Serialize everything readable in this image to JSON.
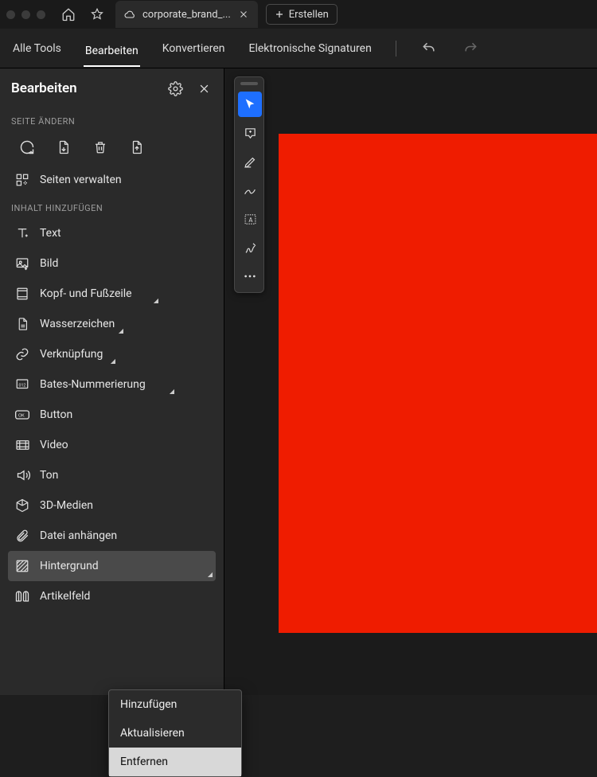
{
  "winbar": {
    "tab_name": "corporate_brand_...",
    "create_label": "Erstellen"
  },
  "menubar": {
    "items": [
      "Alle Tools",
      "Bearbeiten",
      "Konvertieren",
      "Elektronische Signaturen"
    ],
    "active_index": 1
  },
  "panel": {
    "title": "Bearbeiten",
    "section_page": "SEITE ÄNDERN",
    "manage_pages": "Seiten verwalten",
    "section_content": "INHALT HINZUFÜGEN",
    "items": [
      {
        "label": "Text",
        "icon": "text-icon",
        "dropdown": false
      },
      {
        "label": "Bild",
        "icon": "image-icon",
        "dropdown": false
      },
      {
        "label": "Kopf- und Fußzeile",
        "icon": "header-footer-icon",
        "dropdown": true
      },
      {
        "label": "Wasserzeichen",
        "icon": "watermark-icon",
        "dropdown": true
      },
      {
        "label": "Verknüpfung",
        "icon": "link-icon",
        "dropdown": true
      },
      {
        "label": "Bates-Nummerierung",
        "icon": "bates-icon",
        "dropdown": true
      },
      {
        "label": "Button",
        "icon": "button-icon",
        "dropdown": false
      },
      {
        "label": "Video",
        "icon": "video-icon",
        "dropdown": false
      },
      {
        "label": "Ton",
        "icon": "sound-icon",
        "dropdown": false
      },
      {
        "label": "3D-Medien",
        "icon": "three-d-icon",
        "dropdown": false
      },
      {
        "label": "Datei anhängen",
        "icon": "attach-icon",
        "dropdown": false
      },
      {
        "label": "Hintergrund",
        "icon": "background-icon",
        "dropdown": true,
        "selected": true
      },
      {
        "label": "Artikelfeld",
        "icon": "article-icon",
        "dropdown": false
      }
    ]
  },
  "submenu": {
    "items": [
      "Hinzufügen",
      "Aktualisieren",
      "Entfernen"
    ],
    "highlighted_index": 2
  },
  "tools": {
    "items": [
      {
        "name": "select-tool",
        "active": true
      },
      {
        "name": "comment-tool",
        "active": false
      },
      {
        "name": "highlight-tool",
        "active": false
      },
      {
        "name": "draw-tool",
        "active": false
      },
      {
        "name": "typewriter-tool",
        "active": false
      },
      {
        "name": "sign-tool",
        "active": false
      },
      {
        "name": "more-tool",
        "active": false
      }
    ]
  },
  "document": {
    "bg_color": "#ef1c00"
  }
}
